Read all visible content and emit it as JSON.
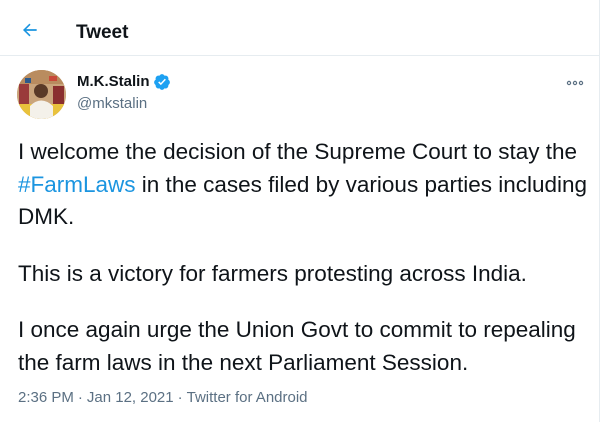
{
  "header": {
    "title": "Tweet"
  },
  "user": {
    "name": "M.K.Stalin",
    "handle": "@mkstalin",
    "verified_icon": "verified-badge-icon"
  },
  "tweet": {
    "line1_before": "I welcome the decision of the Supreme Court to stay the ",
    "hashtag": "#FarmLaws",
    "line1_after": " in the cases filed by various parties including DMK.",
    "para2": "This is a victory for farmers protesting across India.",
    "para3": "I once again urge the Union Govt to commit to repealing the farm laws in the next Parliament Session."
  },
  "meta": {
    "time": "2:36 PM",
    "separator": "·",
    "date": "Jan 12, 2021",
    "source": "Twitter for Android"
  },
  "colors": {
    "accent": "#1b95e0",
    "text": "#0f1419",
    "secondary": "#5b7083",
    "border": "#e6ecf0"
  },
  "icons": {
    "back": "back-arrow-icon",
    "more": "more-options-icon"
  }
}
